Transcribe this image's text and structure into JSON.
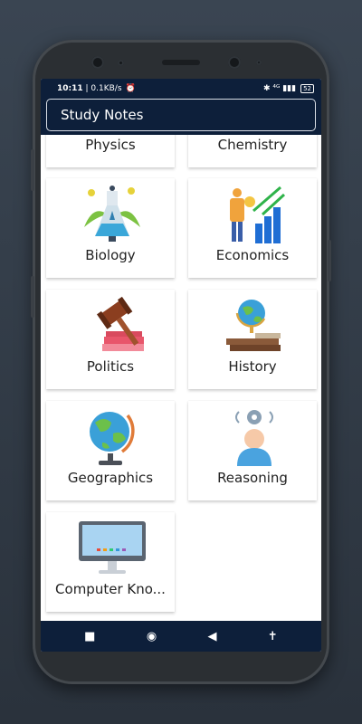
{
  "status": {
    "time": "10:11",
    "speed": "0.1KB/s",
    "icons_right": "✱ ⁴ᴳ ▮▮▮",
    "battery": "52"
  },
  "appbar": {
    "title": "Study Notes"
  },
  "subjects": [
    {
      "label": "Physics",
      "icon": "physics-icon"
    },
    {
      "label": "Chemistry",
      "icon": "chemistry-icon"
    },
    {
      "label": "Biology",
      "icon": "biology-flask-icon"
    },
    {
      "label": "Economics",
      "icon": "economics-growth-icon"
    },
    {
      "label": "Politics",
      "icon": "gavel-books-icon"
    },
    {
      "label": "History",
      "icon": "globe-books-icon"
    },
    {
      "label": "Geographics",
      "icon": "globe-icon"
    },
    {
      "label": "Reasoning",
      "icon": "head-gear-icon"
    },
    {
      "label": "Computer Kno...",
      "icon": "computer-monitor-icon"
    }
  ],
  "navbar": {
    "recent": "■",
    "home": "◉",
    "back": "◀",
    "accessibility": "✝"
  }
}
